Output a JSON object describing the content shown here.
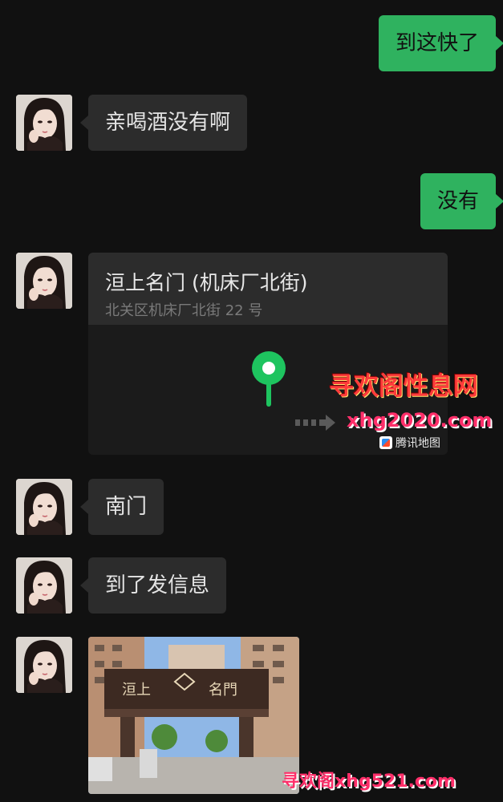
{
  "messages": [
    {
      "sender": "me",
      "text": "到这快了"
    },
    {
      "sender": "contact",
      "text": "亲喝酒没有啊"
    },
    {
      "sender": "me",
      "text": "没有"
    },
    {
      "sender": "contact",
      "type": "location",
      "title": "洹上名门 (机床厂北街)",
      "address": "北关区机床厂北街 22 号",
      "map_brand": "腾讯地图"
    },
    {
      "sender": "contact",
      "text": "南门"
    },
    {
      "sender": "contact",
      "text": "到了发信息"
    },
    {
      "sender": "contact",
      "type": "image",
      "sign_left": "洹上",
      "sign_right": "名門"
    }
  ],
  "watermarks": {
    "site_name": "寻欢阁性息网",
    "site_url": "xhg2020.com",
    "bottom_mark": "寻欢阁xhg521.com"
  },
  "colors": {
    "background": "#111111",
    "incoming_bubble": "#2c2c2c",
    "outgoing_bubble": "#2fb25f",
    "map_pin": "#1ec45f",
    "watermark": "#ff2f6a"
  },
  "icons": [
    "avatar",
    "map-pin-icon",
    "map-nav-arrow-icon",
    "tencent-map-logo-icon"
  ]
}
